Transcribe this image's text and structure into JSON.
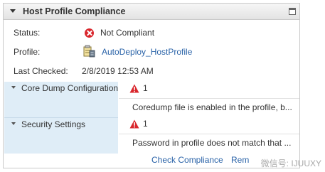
{
  "panel": {
    "title": "Host Profile Compliance"
  },
  "info": {
    "status_label": "Status:",
    "status_value": "Not Compliant",
    "profile_label": "Profile:",
    "profile_value": "AutoDeploy_HostProfile",
    "last_checked_label": "Last Checked:",
    "last_checked_value": "2/8/2019 12:53 AM"
  },
  "sections": [
    {
      "name": "Core Dump Configuration",
      "count": "1",
      "detail": "Coredump file is enabled in the profile, b..."
    },
    {
      "name": "Security Settings",
      "count": "1",
      "detail": "Password in profile does not match that ..."
    }
  ],
  "footer": {
    "check_compliance": "Check Compliance",
    "remediate": "Rem",
    "watermark": "微信号: IJUUXY"
  },
  "colors": {
    "error": "#d9262c",
    "link": "#2a63a8",
    "section_bg": "#dfedf7"
  },
  "icons": {
    "status": "error-circle-icon",
    "profile": "host-profile-icon",
    "warning": "warning-triangle-icon"
  }
}
